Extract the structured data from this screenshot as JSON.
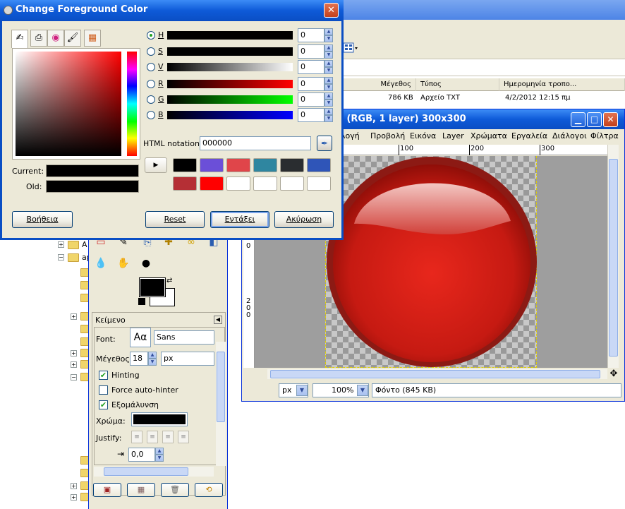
{
  "dialog": {
    "title": "Change Foreground Color",
    "close_glyph": "✕",
    "selector_tabs": [
      {
        "icon": "gimp-wilber-icon"
      },
      {
        "icon": "printer-cmyk-icon"
      },
      {
        "icon": "color-wheel-icon"
      },
      {
        "icon": "watercolor-brush-icon"
      },
      {
        "icon": "palette-icon"
      }
    ],
    "current_label": "Current:",
    "old_label": "Old:",
    "channels": [
      {
        "label": "H",
        "value": "0",
        "selected": true
      },
      {
        "label": "S",
        "value": "0",
        "selected": false
      },
      {
        "label": "V",
        "value": "0",
        "selected": false
      },
      {
        "label": "R",
        "value": "0",
        "selected": false
      },
      {
        "label": "G",
        "value": "0",
        "selected": false
      },
      {
        "label": "B",
        "value": "0",
        "selected": false
      }
    ],
    "html_notation_label": "HTML notation:",
    "html_notation_value": "000000",
    "history_colors": [
      "#000000",
      "#6b4fd8",
      "#e0454a",
      "#2f86a0",
      "#2a2d30",
      "#2f55b8",
      "#b52f35",
      "#ff0000",
      "#ffffff",
      "#ffffff",
      "#ffffff",
      "#ffffff"
    ],
    "buttons": {
      "help": "Βοήθεια",
      "reset": "Reset",
      "ok": "Εντάξει",
      "cancel": "Ακύρωση"
    }
  },
  "explorer": {
    "columns": [
      "Μέγεθος",
      "Τύπος",
      "Ημερομηνία τροπο..."
    ],
    "file_row": {
      "size": "786 KB",
      "type": "Αρχείο TXT",
      "date": "4/2/2012 12:15 πμ"
    },
    "tree_label_a": "A",
    "tree_label_ap": "ap"
  },
  "image_window": {
    "title": ") (RGB, 1 layer) 300x300",
    "menu": [
      "λογή",
      "Προβολή",
      "Εικόνα",
      "Layer",
      "Χρώματα",
      "Εργαλεία",
      "Διάλογοι",
      "Φίλτρα"
    ],
    "ruler_labels": [
      "100",
      "200",
      "300"
    ],
    "vruler_labels": [
      "0",
      "2",
      "0",
      "0"
    ],
    "unit": "px",
    "zoom": "100%",
    "status": "Φόντο (845 KB)"
  },
  "toolbox": {
    "text_options": {
      "title": "Κείμενο",
      "font_label": "Font:",
      "font_preview": "Aα",
      "font_value": "Sans",
      "size_label": "Μέγεθος:",
      "size_value": "18",
      "size_unit": "px",
      "hinting_label": "Hinting",
      "hinting": true,
      "force_autohinter_label": "Force auto-hinter",
      "force_autohinter": false,
      "antialias_label": "Εξομάλυνση",
      "antialias": true,
      "color_label": "Χρώμα:",
      "color_value": "#000000",
      "justify_label": "Justify:",
      "indent_value": "0,0"
    }
  },
  "colors": {
    "xp_blue": "#0a4ec4",
    "dialog_bg": "#ece9d8",
    "ball_red": "#d4201a"
  }
}
